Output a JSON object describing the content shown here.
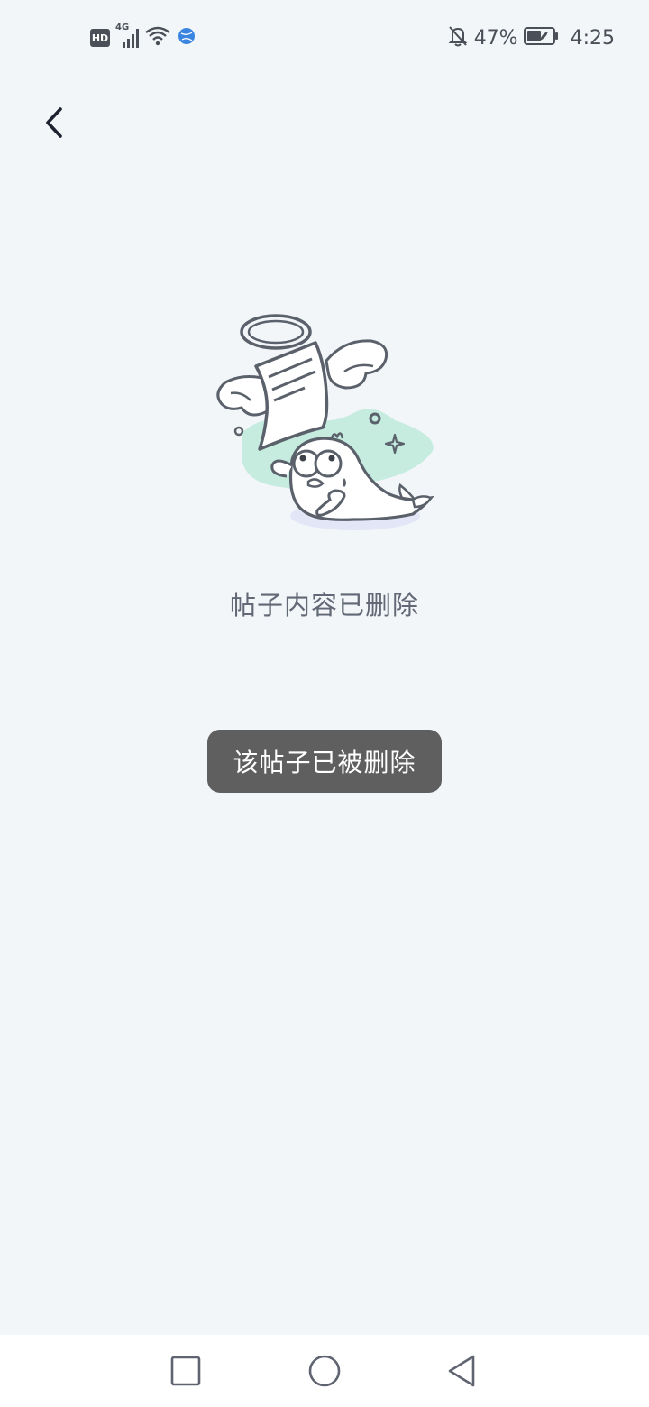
{
  "status_bar": {
    "hd_label": "HD",
    "network_label": "4G",
    "battery_percent": "47%",
    "time": "4:25",
    "icons": [
      "hd-icon",
      "signal-4g-icon",
      "wifi-icon",
      "globe-icon",
      "mute-bell-icon",
      "battery-icon"
    ]
  },
  "header": {
    "back_icon": "chevron-left-icon"
  },
  "main": {
    "illustration": "deleted-post-angel-seal-illustration",
    "message": "帖子内容已删除"
  },
  "toast": {
    "text": "该帖子已被删除"
  },
  "nav_bar": {
    "icons": [
      "square-recents-icon",
      "circle-home-icon",
      "triangle-back-icon"
    ]
  },
  "colors": {
    "background": "#f2f6f9",
    "toast_bg": "#5f5f5f",
    "accent_green": "#c6ecdf",
    "accent_lavender": "#e3e6f7",
    "nav_bg": "#ffffff"
  }
}
